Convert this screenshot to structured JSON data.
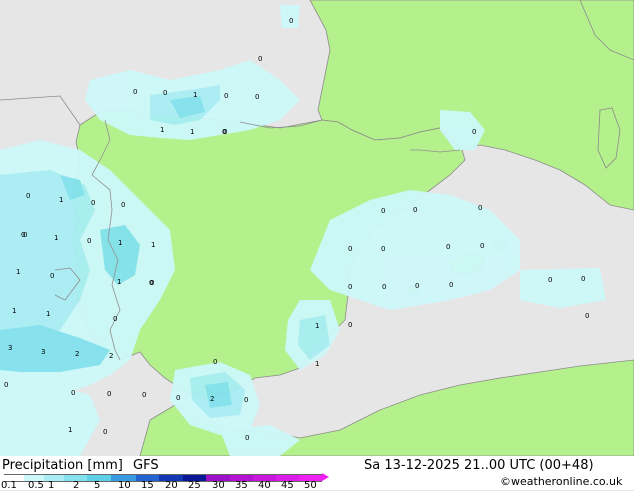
{
  "title": {
    "prefix": "Precipitation [mm]",
    "model": "GFS"
  },
  "valid_time": "Sa 13-12-2025 21..00 UTC (00+48)",
  "credit": "©weatheronline.co.uk",
  "colors": {
    "land": "#b4f08c",
    "sea": "#e6e6e6",
    "coast": "#8c8c8c",
    "border": "#909090"
  },
  "legend": {
    "ticks": [
      "0.1",
      "0.5",
      "1",
      "2",
      "5",
      "10",
      "15",
      "20",
      "25",
      "30",
      "35",
      "40",
      "45",
      "50"
    ],
    "colors": [
      "#ffffff",
      "#cdf8fa",
      "#a9eef4",
      "#84e2ee",
      "#5ed0e8",
      "#3a9ce0",
      "#2464d2",
      "#1238b4",
      "#0a1896",
      "#9c12c8",
      "#b414d2",
      "#c818dc",
      "#dc1ce8",
      "#f020f4"
    ]
  },
  "precip_values": [
    {
      "v": "0"
    },
    {
      "v": "0"
    },
    {
      "v": "0"
    },
    {
      "v": "1"
    },
    {
      "v": "0"
    },
    {
      "v": "0"
    },
    {
      "v": "0"
    },
    {
      "v": "0"
    },
    {
      "v": "1"
    },
    {
      "v": "1"
    },
    {
      "v": "0"
    },
    {
      "v": "0"
    },
    {
      "v": "0"
    },
    {
      "v": "1"
    },
    {
      "v": "0"
    },
    {
      "v": "0"
    },
    {
      "v": "0"
    },
    {
      "v": "1"
    },
    {
      "v": "1"
    },
    {
      "v": "1"
    },
    {
      "v": "1"
    },
    {
      "v": "0"
    },
    {
      "v": "1"
    },
    {
      "v": "0"
    },
    {
      "v": "1"
    },
    {
      "v": "1"
    },
    {
      "v": "0"
    },
    {
      "v": "3"
    },
    {
      "v": "3"
    },
    {
      "v": "2"
    },
    {
      "v": "2"
    },
    {
      "v": "0"
    },
    {
      "v": "0"
    },
    {
      "v": "0"
    },
    {
      "v": "0"
    },
    {
      "v": "0"
    },
    {
      "v": "1"
    },
    {
      "v": "0"
    },
    {
      "v": "0"
    },
    {
      "v": "0"
    },
    {
      "v": "0"
    },
    {
      "v": "2"
    },
    {
      "v": "0"
    },
    {
      "v": "0"
    },
    {
      "v": "0"
    },
    {
      "v": "0"
    },
    {
      "v": "0"
    },
    {
      "v": "0"
    },
    {
      "v": "0"
    },
    {
      "v": "0"
    },
    {
      "v": "0"
    },
    {
      "v": "0"
    },
    {
      "v": "0"
    },
    {
      "v": "0"
    },
    {
      "v": "0"
    },
    {
      "v": "0"
    },
    {
      "v": "0"
    },
    {
      "v": "1"
    },
    {
      "v": "1"
    },
    {
      "v": "0"
    },
    {
      "v": "0"
    },
    {
      "v": "0"
    }
  ]
}
